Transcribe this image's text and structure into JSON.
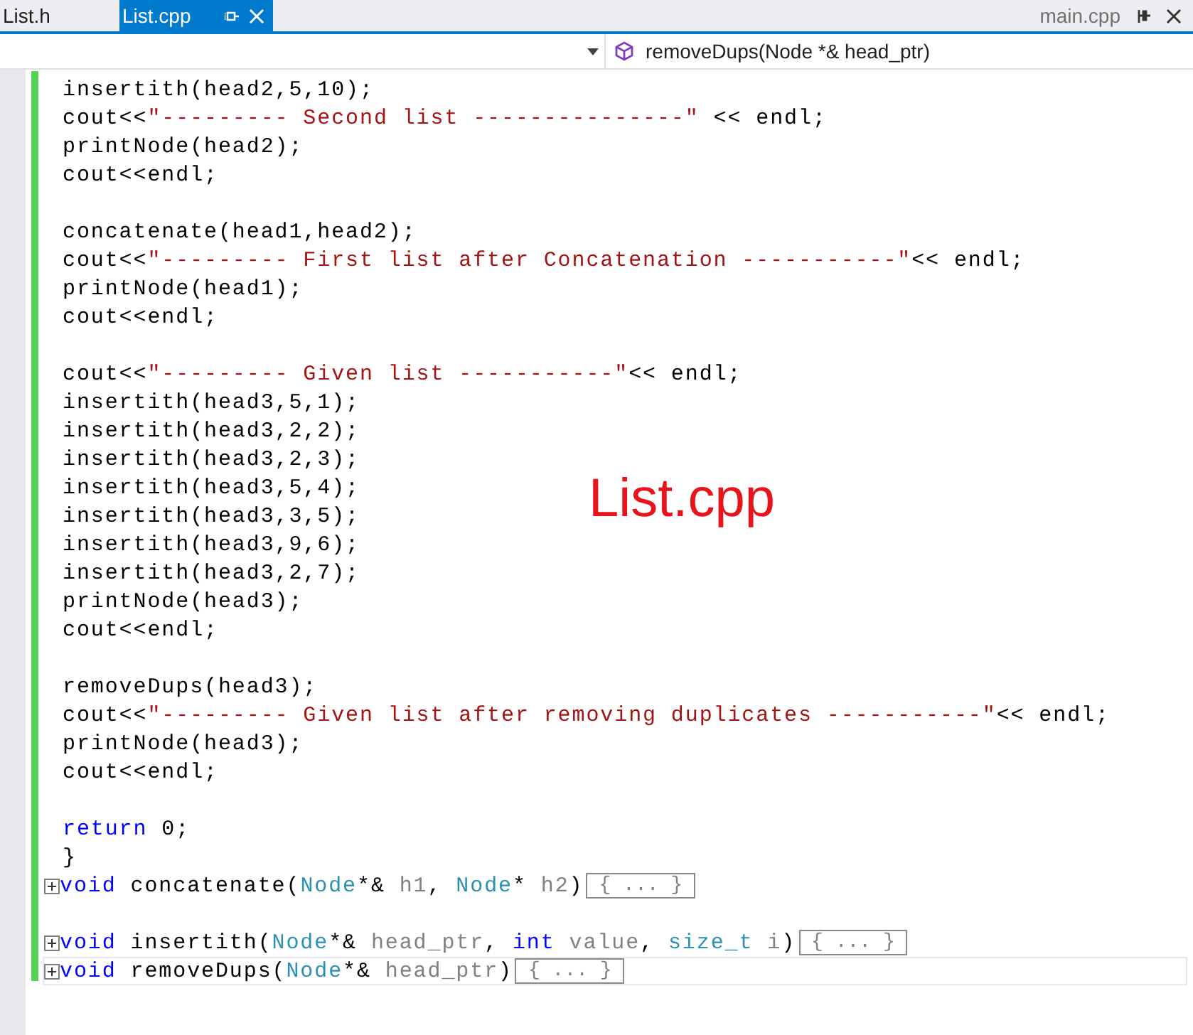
{
  "tabs": [
    {
      "label": "List.h",
      "selected": false
    },
    {
      "label": "List.cpp",
      "selected": true
    }
  ],
  "right_tab": {
    "label": "main.cpp"
  },
  "nav_bar": {
    "member": "removeDups(Node *& head_ptr)"
  },
  "code_lines": [
    {
      "kind": "code",
      "tokens": [
        {
          "kind": "plain",
          "text": "insertith(head2,5,10);"
        }
      ]
    },
    {
      "kind": "code",
      "tokens": [
        {
          "kind": "plain",
          "text": "cout<<"
        },
        {
          "kind": "string",
          "text": "\"--------- Second list ---------------\""
        },
        {
          "kind": "plain",
          "text": " << endl;"
        }
      ]
    },
    {
      "kind": "code",
      "tokens": [
        {
          "kind": "plain",
          "text": "printNode(head2);"
        }
      ]
    },
    {
      "kind": "code",
      "tokens": [
        {
          "kind": "plain",
          "text": "cout<<endl;"
        }
      ]
    },
    {
      "kind": "blank"
    },
    {
      "kind": "code",
      "tokens": [
        {
          "kind": "plain",
          "text": "concatenate(head1,head2);"
        }
      ]
    },
    {
      "kind": "code",
      "tokens": [
        {
          "kind": "plain",
          "text": "cout<<"
        },
        {
          "kind": "string",
          "text": "\"--------- First list after Concatenation -----------\""
        },
        {
          "kind": "plain",
          "text": "<< endl;"
        }
      ]
    },
    {
      "kind": "code",
      "tokens": [
        {
          "kind": "plain",
          "text": "printNode(head1);"
        }
      ]
    },
    {
      "kind": "code",
      "tokens": [
        {
          "kind": "plain",
          "text": "cout<<endl;"
        }
      ]
    },
    {
      "kind": "blank"
    },
    {
      "kind": "code",
      "tokens": [
        {
          "kind": "plain",
          "text": "cout<<"
        },
        {
          "kind": "string",
          "text": "\"--------- Given list -----------\""
        },
        {
          "kind": "plain",
          "text": "<< endl;"
        }
      ]
    },
    {
      "kind": "code",
      "tokens": [
        {
          "kind": "plain",
          "text": "insertith(head3,5,1);"
        }
      ]
    },
    {
      "kind": "code",
      "tokens": [
        {
          "kind": "plain",
          "text": "insertith(head3,2,2);"
        }
      ]
    },
    {
      "kind": "code",
      "tokens": [
        {
          "kind": "plain",
          "text": "insertith(head3,2,3);"
        }
      ]
    },
    {
      "kind": "code",
      "tokens": [
        {
          "kind": "plain",
          "text": "insertith(head3,5,4);"
        }
      ]
    },
    {
      "kind": "code",
      "tokens": [
        {
          "kind": "plain",
          "text": "insertith(head3,3,5);"
        }
      ]
    },
    {
      "kind": "code",
      "tokens": [
        {
          "kind": "plain",
          "text": "insertith(head3,9,6);"
        }
      ]
    },
    {
      "kind": "code",
      "tokens": [
        {
          "kind": "plain",
          "text": "insertith(head3,2,7);"
        }
      ]
    },
    {
      "kind": "code",
      "tokens": [
        {
          "kind": "plain",
          "text": "printNode(head3);"
        }
      ]
    },
    {
      "kind": "code",
      "tokens": [
        {
          "kind": "plain",
          "text": "cout<<endl;"
        }
      ]
    },
    {
      "kind": "blank"
    },
    {
      "kind": "code",
      "tokens": [
        {
          "kind": "plain",
          "text": "removeDups(head3);"
        }
      ]
    },
    {
      "kind": "code",
      "tokens": [
        {
          "kind": "plain",
          "text": "cout<<"
        },
        {
          "kind": "string",
          "text": "\"--------- Given list after removing duplicates -----------\""
        },
        {
          "kind": "plain",
          "text": "<< endl;"
        }
      ]
    },
    {
      "kind": "code",
      "tokens": [
        {
          "kind": "plain",
          "text": "printNode(head3);"
        }
      ]
    },
    {
      "kind": "code",
      "tokens": [
        {
          "kind": "plain",
          "text": "cout<<endl;"
        }
      ]
    },
    {
      "kind": "blank"
    },
    {
      "kind": "code",
      "tokens": [
        {
          "kind": "keyword",
          "text": "return"
        },
        {
          "kind": "plain",
          "text": " 0;"
        }
      ]
    },
    {
      "kind": "code",
      "tokens": [
        {
          "kind": "plain",
          "text": "}"
        }
      ]
    },
    {
      "kind": "fold",
      "current": false,
      "collapsed": "{ ... }",
      "tokens": [
        {
          "kind": "keyword",
          "text": "void"
        },
        {
          "kind": "plain",
          "text": " concatenate("
        },
        {
          "kind": "type",
          "text": "Node"
        },
        {
          "kind": "plain",
          "text": "*& "
        },
        {
          "kind": "param",
          "text": "h1"
        },
        {
          "kind": "plain",
          "text": ", "
        },
        {
          "kind": "type",
          "text": "Node"
        },
        {
          "kind": "plain",
          "text": "* "
        },
        {
          "kind": "param",
          "text": "h2"
        },
        {
          "kind": "plain",
          "text": ")"
        }
      ]
    },
    {
      "kind": "blank"
    },
    {
      "kind": "fold",
      "current": false,
      "collapsed": "{ ... }",
      "tokens": [
        {
          "kind": "keyword",
          "text": "void"
        },
        {
          "kind": "plain",
          "text": " insertith("
        },
        {
          "kind": "type",
          "text": "Node"
        },
        {
          "kind": "plain",
          "text": "*& "
        },
        {
          "kind": "param",
          "text": "head_ptr"
        },
        {
          "kind": "plain",
          "text": ", "
        },
        {
          "kind": "keyword",
          "text": "int"
        },
        {
          "kind": "param",
          "text": " value"
        },
        {
          "kind": "plain",
          "text": ", "
        },
        {
          "kind": "type",
          "text": "size_t"
        },
        {
          "kind": "param",
          "text": " i"
        },
        {
          "kind": "plain",
          "text": ")"
        }
      ]
    },
    {
      "kind": "fold",
      "current": true,
      "collapsed": "{ ... }",
      "tokens": [
        {
          "kind": "keyword",
          "text": "void"
        },
        {
          "kind": "plain",
          "text": " removeDups("
        },
        {
          "kind": "type",
          "text": "Node"
        },
        {
          "kind": "plain",
          "text": "*& "
        },
        {
          "kind": "param",
          "text": "head_ptr"
        },
        {
          "kind": "plain",
          "text": ")"
        }
      ]
    }
  ],
  "overlay_caption": "List.cpp"
}
